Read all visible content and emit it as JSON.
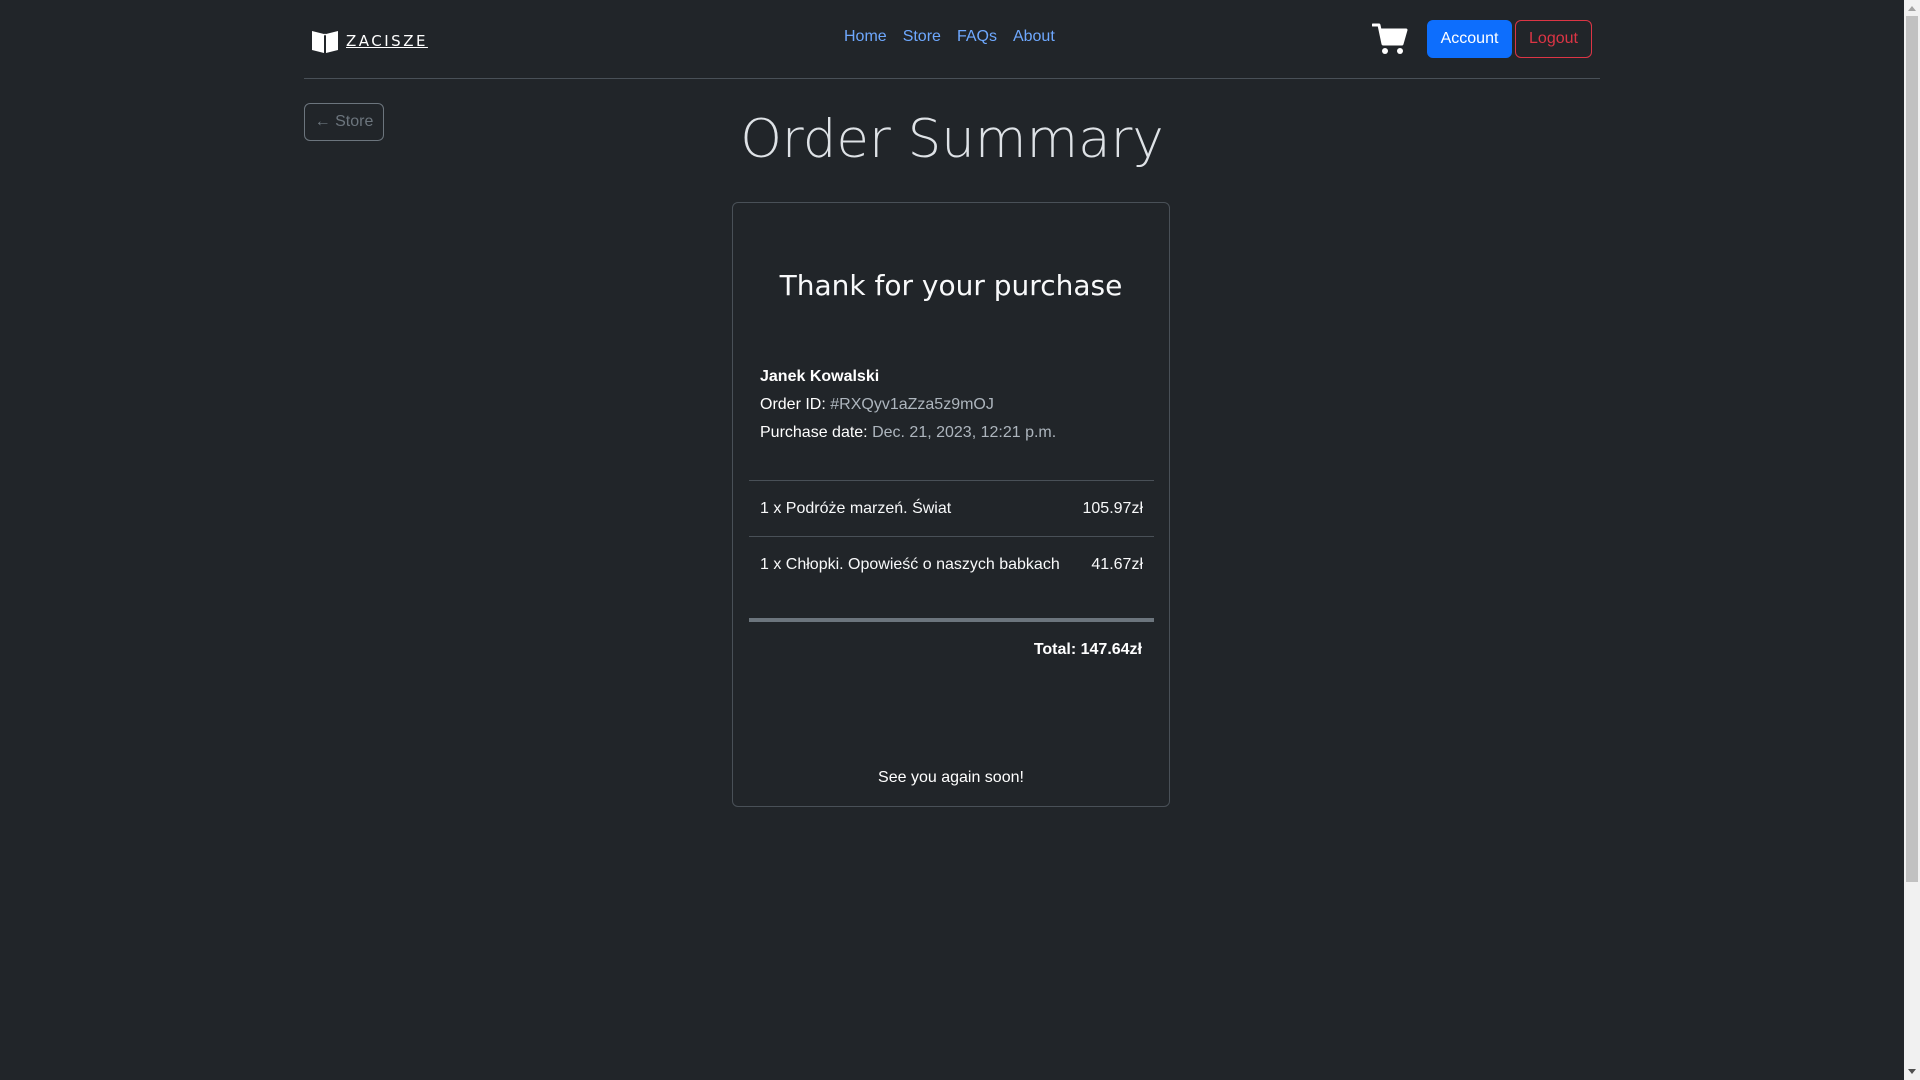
{
  "brand": {
    "name": "ZACISZE"
  },
  "nav": {
    "items": [
      "Home",
      "Store",
      "FAQs",
      "About"
    ]
  },
  "header": {
    "account_label": "Account",
    "logout_label": "Logout"
  },
  "back_button": {
    "label": "← Store"
  },
  "page": {
    "title": "Order Summary"
  },
  "order": {
    "heading": "Thank for your purchase",
    "customer_name": "Janek Kowalski",
    "order_id_label": "Order ID:",
    "order_id": "#RXQyv1aZza5z9mOJ",
    "purchase_date_label": "Purchase date:",
    "purchase_date": "Dec. 21, 2023, 12:21 p.m.",
    "items": [
      {
        "description": "1 x Podróże marzeń. Świat",
        "price": "105.97zł"
      },
      {
        "description": "1 x Chłopki. Opowieść o naszych babkach",
        "price": "41.67zł"
      }
    ],
    "total": "Total: 147.64zł",
    "farewell": "See you again soon!"
  },
  "colors": {
    "background": "#212529",
    "link": "#6ea8fe",
    "primary": "#0d6efd",
    "danger": "#dc3545",
    "secondary": "#6c757d"
  }
}
